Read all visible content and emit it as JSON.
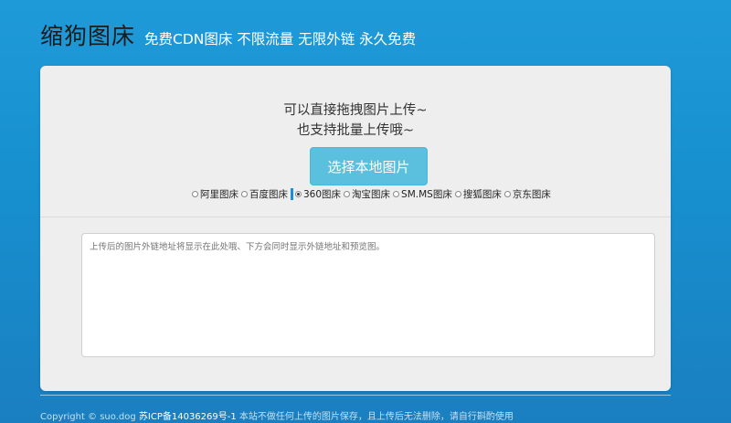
{
  "header": {
    "brand": "缩狗图床",
    "tagline": "免费CDN图床 不限流量 无限外链 永久免费"
  },
  "upload": {
    "hint_line1": "可以直接拖拽图片上传~",
    "hint_line2": "也支持批量上传哦~",
    "button_label": "选择本地图片"
  },
  "hosts": {
    "selected": "360图床",
    "options": [
      {
        "label": "阿里图床"
      },
      {
        "label": "百度图床"
      },
      {
        "label": "360图床"
      },
      {
        "label": "淘宝图床"
      },
      {
        "label": "SM.MS图床"
      },
      {
        "label": "搜狐图床"
      },
      {
        "label": "京东图床"
      }
    ]
  },
  "output": {
    "placeholder": "上传后的图片外链地址将显示在此处哦、下方会同时显示外链地址和预览图。"
  },
  "footer": {
    "copyright": "Copyright © suo.dog ",
    "icp": "苏ICP备14036269号-1",
    "notice": " 本站不做任何上传的图片保存，且上传后无法删除，请自行斟酌使用"
  },
  "colors": {
    "background": "#1f9ad8",
    "button": "#5bc0de",
    "panel": "#eeeeee"
  }
}
